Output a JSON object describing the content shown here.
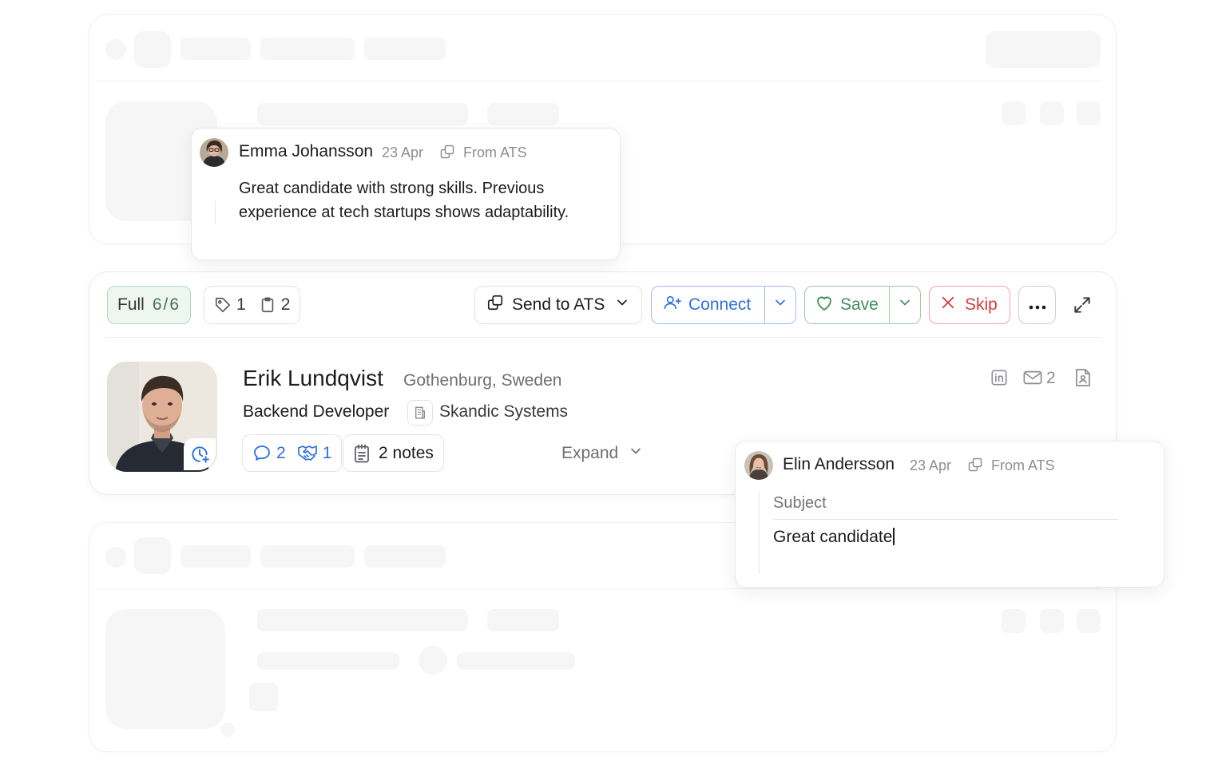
{
  "top_note": {
    "author": "Emma Johansson",
    "date": "23 Apr",
    "source": "From ATS",
    "body": "Great candidate with strong skills. Previous experience at tech startups shows adaptability."
  },
  "toolbar": {
    "profile_label": "Full",
    "profile_count": "6/6",
    "tags_count": "1",
    "clipboard_count": "2",
    "send_label": "Send to ATS",
    "connect_label": "Connect",
    "save_label": "Save",
    "skip_label": "Skip"
  },
  "candidate": {
    "name": "Erik Lundqvist",
    "location": "Gothenburg, Sweden",
    "title": "Backend Developer",
    "company": "Skandic Systems",
    "email_count": "2",
    "messages_count": "2",
    "handshake_count": "1",
    "notes_label": "2 notes",
    "expand_label": "Expand"
  },
  "compose_note": {
    "author": "Elin Andersson",
    "date": "23 Apr",
    "source": "From ATS",
    "subject_placeholder": "Subject",
    "body": "Great candidate"
  },
  "colors": {
    "accent_blue": "#2f6fe0",
    "save_green": "#3f8f5a",
    "skip_red": "#d63b3b",
    "full_chip_bg": "#edf6ef",
    "full_chip_border": "#b5d8bf"
  }
}
